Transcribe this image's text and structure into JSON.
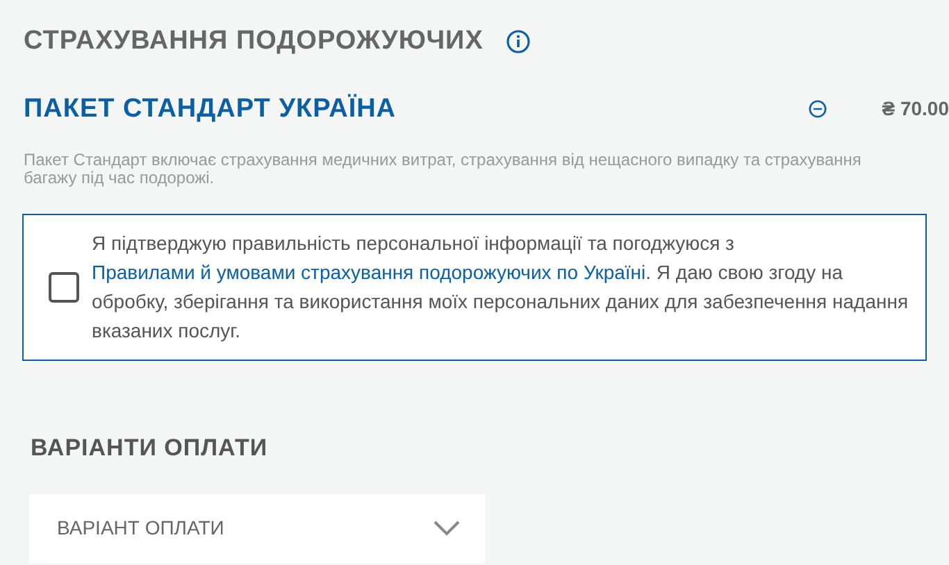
{
  "section_title": "СТРАХУВАННЯ ПОДОРОЖУЮЧИХ",
  "package": {
    "name": "ПАКЕТ СТАНДАРТ УКРАЇНА",
    "price": "₴ 70.00",
    "description": "Пакет Стандарт включає страхування медичних витрат, страхування від нещасного випадку та страхування багажу під час подорожі."
  },
  "consent": {
    "checked": false,
    "text_before": "Я підтверджую правильність персональної інформації та погоджуюся з",
    "link": "Правилами й умовами страхування подорожуючих по Україні",
    "text_after": ". Я даю свою згоду на обробку, зберігання та використання моїх персональних даних для забезпечення надання вказаних послуг."
  },
  "payment": {
    "title": "ВАРІАНТИ ОПЛАТИ",
    "select": {
      "placeholder": "ВАРІАНТ ОПЛАТИ"
    }
  }
}
